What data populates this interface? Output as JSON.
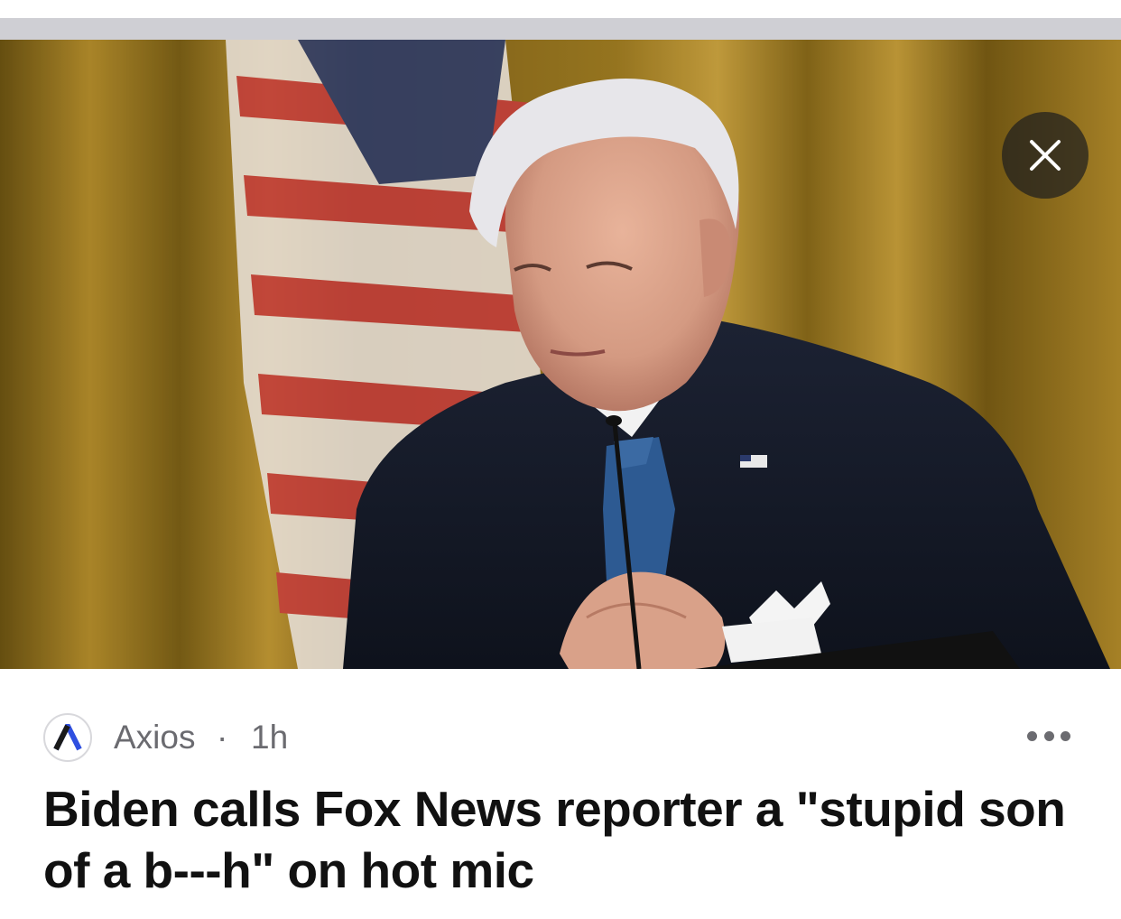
{
  "card": {
    "close_icon": "close-icon",
    "more_icon": "ellipsis-icon",
    "source": {
      "logo_letter": "A",
      "name": "Axios",
      "separator": "·",
      "time": "1h"
    },
    "headline": "Biden calls Fox News reporter a \"stupid son of a b---h\" on hot mic"
  },
  "colors": {
    "grey_bar": "#cfcfd4",
    "meta_text": "#6b6b70",
    "headline_text": "#111111",
    "logo_blue": "#2f4fe0"
  }
}
